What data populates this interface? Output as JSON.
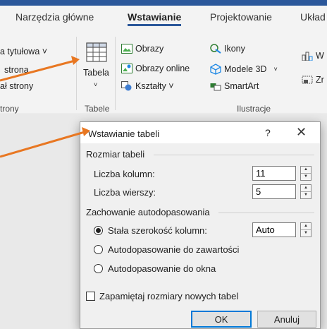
{
  "ribbon": {
    "tabs": [
      {
        "label": "Narzędzia główne"
      },
      {
        "label": "Wstawianie"
      },
      {
        "label": "Projektowanie"
      },
      {
        "label": "Układ"
      }
    ],
    "strony_group": {
      "items": [
        "a tytułowa ˅",
        "strona",
        "ał strony"
      ],
      "label": "trony"
    },
    "tabele_group": {
      "button_label": "Tabela",
      "label": "Tabele"
    },
    "ilustracje_group": {
      "items": [
        "Obrazy",
        "Obrazy online",
        "Kształty ˅",
        "Ikony",
        "Modele 3D",
        "SmartArt"
      ],
      "label": "Ilustracje"
    },
    "extra": [
      "W",
      "Zr"
    ]
  },
  "dialog": {
    "title": "Wstawianie tabeli",
    "help": "?",
    "close": "✕",
    "section_size": "Rozmiar tabeli",
    "columns_label": "Liczba kolumn:",
    "columns_value": "11",
    "rows_label": "Liczba wierszy:",
    "rows_value": "5",
    "section_autofit": "Zachowanie autodopasowania",
    "fixed_width_label": "Stała szerokość kolumn:",
    "fixed_width_value": "Auto",
    "autofit_contents_label": "Autodopasowanie do zawartości",
    "autofit_window_label": "Autodopasowanie do okna",
    "remember_label": "Zapamiętaj rozmiary nowych tabel",
    "ok_label": "OK",
    "cancel_label": "Anuluj"
  },
  "colors": {
    "accent": "#2b579a",
    "arrow": "#e87722",
    "ok_border": "#0078d7"
  }
}
